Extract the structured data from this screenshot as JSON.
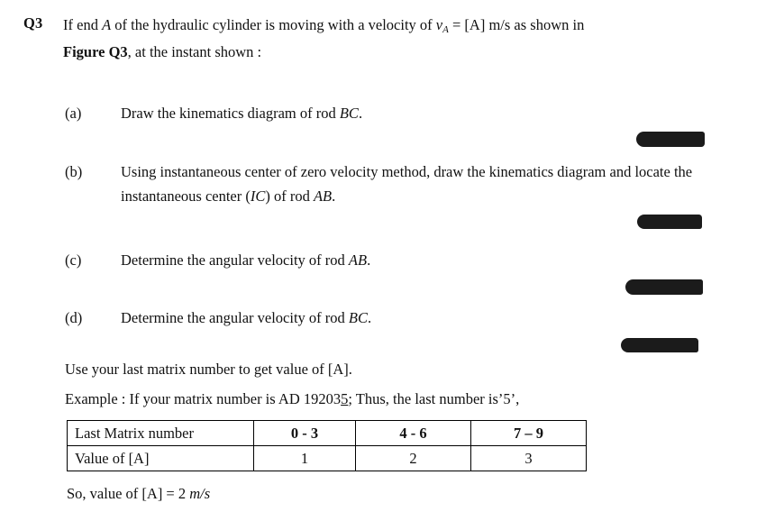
{
  "question": {
    "number": "Q3",
    "stem_line1_a": "If end ",
    "stem_line1_var1": "A",
    "stem_line1_b": " of the hydraulic cylinder is moving with a velocity of  ",
    "stem_line1_v": "v",
    "stem_line1_vsub": "A",
    "stem_line1_c": " = [A] m/s as shown in",
    "stem_line2_fig": "Figure Q3",
    "stem_line2_rest": ", at the instant shown :"
  },
  "parts": [
    {
      "marker": "(a)",
      "text_a": "Draw the kinematics diagram of rod ",
      "text_italic": "BC",
      "text_b": "."
    },
    {
      "marker": "(b)",
      "text_a": "Using instantaneous center of zero velocity method, draw the kinematics diagram and",
      "text_b_a": "locate the instantaneous center (",
      "text_b_italic1": "IC",
      "text_b_b": ") of rod ",
      "text_b_italic2": "AB",
      "text_b_c": "."
    },
    {
      "marker": "(c)",
      "text_a": "Determine the angular velocity of rod ",
      "text_italic": "AB",
      "text_b": "."
    },
    {
      "marker": "(d)",
      "text_a": "Determine the angular velocity of rod ",
      "text_italic": "BC",
      "text_b": "."
    }
  ],
  "notes": {
    "use_last_matrix": "Use your last matrix number to get value of [A].",
    "example_a": "Example : If your matrix number is AD 19203",
    "example_underlined": "5",
    "example_b": "; Thus, the last number is’5’,",
    "final_a": "So, value of [A] = 2 ",
    "final_italic": "m/s"
  },
  "table": {
    "header": [
      "Last Matrix number",
      "0 - 3",
      "4 - 6",
      "7 – 9"
    ],
    "row": [
      "Value of [A]",
      "1",
      "2",
      "3"
    ]
  }
}
